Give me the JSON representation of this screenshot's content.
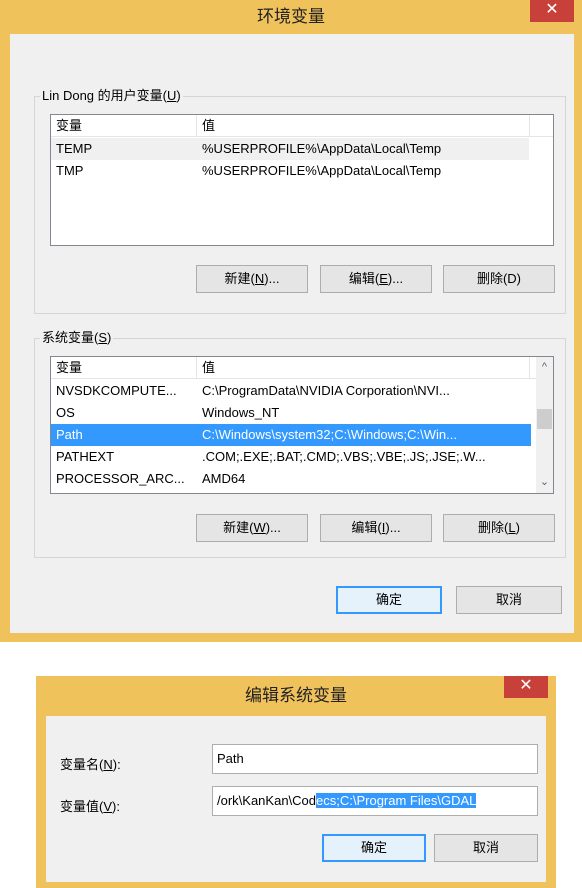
{
  "env_dialog": {
    "title": "环境变量",
    "close_glyph": "✕",
    "user_group": {
      "title_prefix": "Lin Dong 的用户变量(",
      "title_key": "U",
      "title_suffix": ")",
      "columns": [
        "变量",
        "值"
      ],
      "rows": [
        {
          "name": "TEMP",
          "value": "%USERPROFILE%\\AppData\\Local\\Temp"
        },
        {
          "name": "TMP",
          "value": "%USERPROFILE%\\AppData\\Local\\Temp"
        }
      ],
      "buttons": {
        "new_prefix": "新建(",
        "new_key": "N",
        "new_suffix": ")...",
        "edit_prefix": "编辑(",
        "edit_key": "E",
        "edit_suffix": ")...",
        "delete": "删除(D)"
      }
    },
    "system_group": {
      "title_prefix": "系统变量(",
      "title_key": "S",
      "title_suffix": ")",
      "columns": [
        "变量",
        "值"
      ],
      "rows": [
        {
          "name": "NVSDKCOMPUTE...",
          "value": "C:\\ProgramData\\NVIDIA Corporation\\NVI..."
        },
        {
          "name": "OS",
          "value": "Windows_NT"
        },
        {
          "name": "Path",
          "value": "C:\\Windows\\system32;C:\\Windows;C:\\Win..."
        },
        {
          "name": "PATHEXT",
          "value": ".COM;.EXE;.BAT;.CMD;.VBS;.VBE;.JS;.JSE;.W..."
        },
        {
          "name": "PROCESSOR_ARC...",
          "value": "AMD64"
        }
      ],
      "buttons": {
        "new_prefix": "新建(",
        "new_key": "W",
        "new_suffix": ")...",
        "edit_prefix": "编辑(",
        "edit_key": "I",
        "edit_suffix": ")...",
        "delete_prefix": "删除(",
        "delete_key": "L",
        "delete_suffix": ")"
      }
    },
    "ok": "确定",
    "cancel": "取消"
  },
  "edit_dialog": {
    "title": "编辑系统变量",
    "close_glyph": "✕",
    "name_label_prefix": "变量名(",
    "name_label_key": "N",
    "name_label_suffix": "):",
    "value_label_prefix": "变量值(",
    "value_label_key": "V",
    "value_label_suffix": "):",
    "name_value": "Path",
    "value_unselected": "/ork\\KanKan\\Cod",
    "value_selected": "ecs;C:\\Program Files\\GDAL",
    "ok": "确定",
    "cancel": "取消"
  },
  "colors": {
    "window_frame": "#f0c25c",
    "close_button": "#c7403a",
    "selection": "#3399ff"
  }
}
